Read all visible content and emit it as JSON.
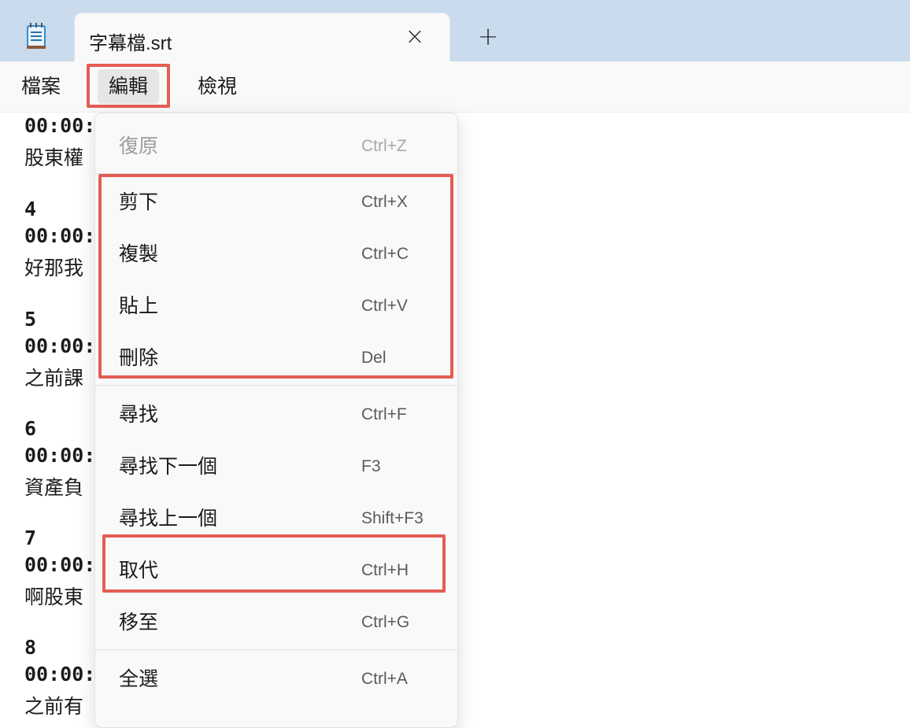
{
  "tab": {
    "title": "字幕檔.srt",
    "close_icon": "close-icon",
    "new_tab_icon": "plus-icon"
  },
  "menubar": {
    "file": "檔案",
    "edit": "編輯",
    "view": "檢視"
  },
  "editor": {
    "lines": [
      "00:00:",
      "股東權",
      "",
      "4",
      "00:00:",
      "好那我",
      "",
      "5",
      "00:00:",
      "之前課",
      "",
      "6",
      "00:00:",
      "資產負",
      "",
      "7",
      "00:00:",
      "啊股東",
      "",
      "8",
      "00:00:",
      "之前有"
    ]
  },
  "edit_menu": {
    "items": [
      {
        "label": "復原",
        "shortcut": "Ctrl+Z",
        "enabled": false
      },
      {
        "label": "剪下",
        "shortcut": "Ctrl+X",
        "enabled": true
      },
      {
        "label": "複製",
        "shortcut": "Ctrl+C",
        "enabled": true
      },
      {
        "label": "貼上",
        "shortcut": "Ctrl+V",
        "enabled": true
      },
      {
        "label": "刪除",
        "shortcut": "Del",
        "enabled": true
      },
      {
        "label": "尋找",
        "shortcut": "Ctrl+F",
        "enabled": true
      },
      {
        "label": "尋找下一個",
        "shortcut": "F3",
        "enabled": true
      },
      {
        "label": "尋找上一個",
        "shortcut": "Shift+F3",
        "enabled": true
      },
      {
        "label": "取代",
        "shortcut": "Ctrl+H",
        "enabled": true
      },
      {
        "label": "移至",
        "shortcut": "Ctrl+G",
        "enabled": true
      },
      {
        "label": "全選",
        "shortcut": "Ctrl+A",
        "enabled": true
      }
    ]
  },
  "colors": {
    "highlight": "#e35d55",
    "tabbar": "#c9dbec"
  }
}
